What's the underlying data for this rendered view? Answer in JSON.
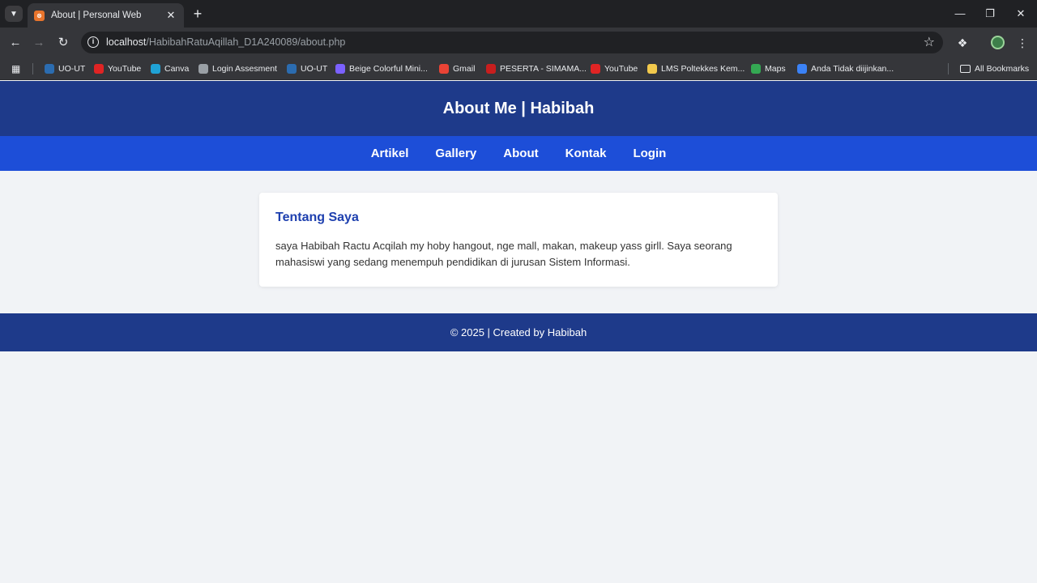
{
  "browser": {
    "tab_title": "About | Personal Web",
    "tab_favicon": "XAMPP",
    "url_host": "localhost",
    "url_path": "/HabibahRatuAqillah_D1A240089/about.php",
    "all_bookmarks": "All Bookmarks",
    "bookmarks": [
      {
        "label": "UO-UT",
        "icon": "ut-icon",
        "color": "#2b6cb0"
      },
      {
        "label": "YouTube",
        "icon": "youtube-icon",
        "color": "#e02424"
      },
      {
        "label": "Canva",
        "icon": "canva-icon",
        "color": "#1fa2d6"
      },
      {
        "label": "Login Assesment",
        "icon": "globe-icon",
        "color": "#9aa0a6"
      },
      {
        "label": "UO-UT",
        "icon": "ut-icon",
        "color": "#2b6cb0"
      },
      {
        "label": "Beige Colorful Mini...",
        "icon": "canva-icon",
        "color": "#7b61ff"
      },
      {
        "label": "Gmail",
        "icon": "gmail-icon",
        "color": "#ea4335"
      },
      {
        "label": "PESERTA - SIMAMA...",
        "icon": "simama-icon",
        "color": "#c81e1e"
      },
      {
        "label": "YouTube",
        "icon": "youtube-icon",
        "color": "#e02424"
      },
      {
        "label": "LMS Poltekkes Kem...",
        "icon": "lms-icon",
        "color": "#f2c94c"
      },
      {
        "label": "Maps",
        "icon": "maps-icon",
        "color": "#34a853"
      },
      {
        "label": "Anda Tidak diijinkan...",
        "icon": "kemdikbud-icon",
        "color": "#3b82f6"
      }
    ]
  },
  "page": {
    "title": "About Me | Habibah",
    "nav": [
      "Artikel",
      "Gallery",
      "About",
      "Kontak",
      "Login"
    ],
    "card_title": "Tentang Saya",
    "card_text": "saya Habibah Ractu Acqilah my hoby hangout, nge mall, makan, makeup yass girll. Saya seorang mahasiswi yang sedang menempuh pendidikan di jurusan Sistem Informasi.",
    "footer": "© 2025 | Created by Habibah"
  },
  "colors": {
    "header": "#1e3a8a",
    "nav": "#1d4ed8",
    "accent": "#1e40af",
    "page_bg": "#f1f3f6"
  }
}
